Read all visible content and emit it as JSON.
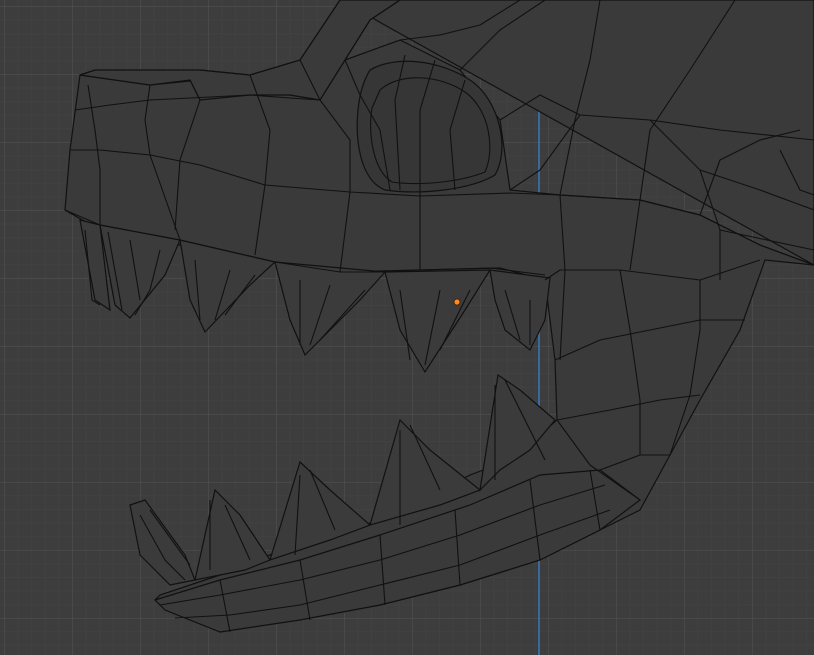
{
  "viewport": {
    "mode": "3d-viewport-wireframe",
    "background_color": "#3d3d3d",
    "grid_color": "#505050",
    "axis_color": "#3a6ea8",
    "edge_color": "#111111",
    "face_color": "#3a3a3a",
    "origin_color": "#ff8a1e"
  },
  "object": {
    "icon": "origin-dot-icon"
  }
}
